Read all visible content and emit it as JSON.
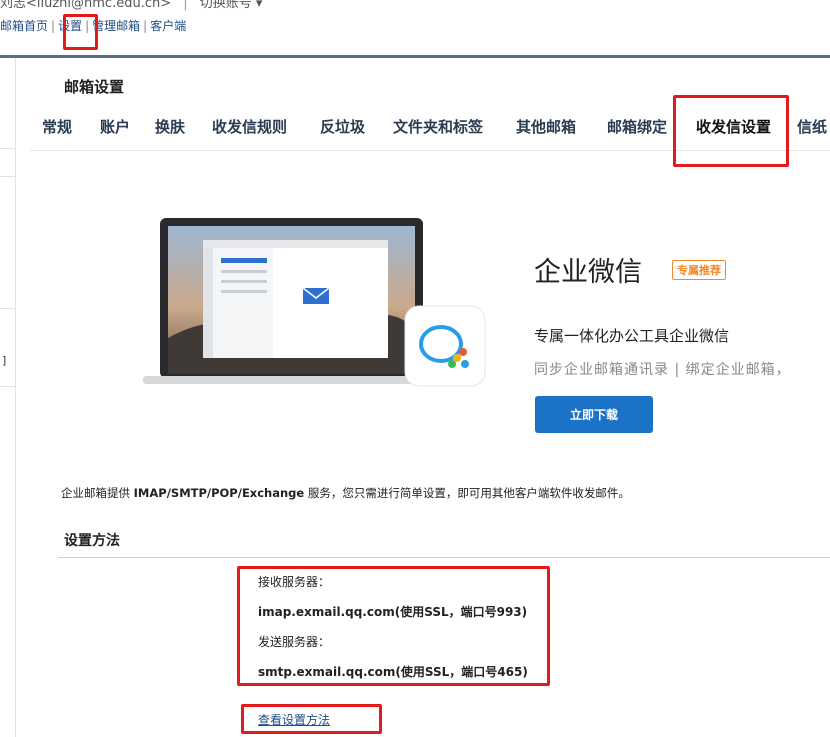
{
  "header": {
    "account_text": "刘志<liuzhi@hmc.edu.cn>",
    "separator": "|",
    "switch_account": "切换账号 ▾",
    "nav": [
      {
        "label": "邮箱首页"
      },
      {
        "label": "设置"
      },
      {
        "label": "管理邮箱"
      },
      {
        "label": "客户端"
      }
    ]
  },
  "sidebar": {
    "fragment": "]"
  },
  "page_title": "邮箱设置",
  "tabs": [
    {
      "label": "常规"
    },
    {
      "label": "账户"
    },
    {
      "label": "换肤"
    },
    {
      "label": "收发信规则"
    },
    {
      "label": "反垃圾"
    },
    {
      "label": "文件夹和标签"
    },
    {
      "label": "其他邮箱"
    },
    {
      "label": "邮箱绑定"
    },
    {
      "label": "收发信设置"
    },
    {
      "label": "信纸"
    }
  ],
  "promo": {
    "title": "企业微信",
    "badge": "专属推荐",
    "subtitle": "专属一体化办公工具企业微信",
    "description": "同步企业邮箱通讯录 | 绑定企业邮箱，",
    "download_label": "立即下载"
  },
  "intro": {
    "prefix": "企业邮箱提供 ",
    "protocols": "IMAP/SMTP/POP/Exchange",
    "suffix": " 服务，您只需进行简单设置，即可用其他客户端软件收发邮件。"
  },
  "method": {
    "title": "设置方法",
    "incoming_label": "接收服务器：",
    "incoming_value": "imap.exmail.qq.com(使用SSL，端口号993)",
    "outgoing_label": "发送服务器：",
    "outgoing_value": "smtp.exmail.qq.com(使用SSL，端口号465)",
    "link_label": "查看设置方法"
  },
  "colors": {
    "accent_blue": "#1b72c7",
    "annotation_red": "#e11b1b",
    "badge_orange": "#f08a2c"
  }
}
